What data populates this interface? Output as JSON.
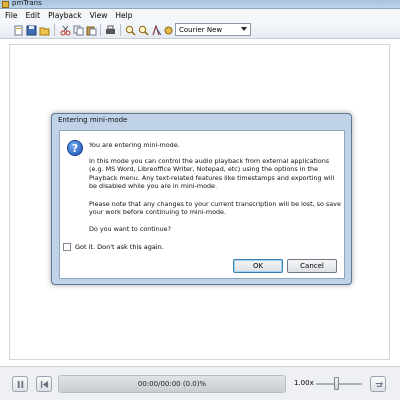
{
  "window": {
    "title": "pmTrans"
  },
  "menubar": {
    "items": [
      "File",
      "Edit",
      "Playback",
      "View",
      "Help"
    ]
  },
  "toolbar": {
    "font_select": "Courier New"
  },
  "dialog": {
    "title": "Entering mini-mode",
    "p1": "You are entering mini-mode.",
    "p2": "In this mode you can control the audio playback from external applications (e.g. MS Word, Libreoffice Writer, Notepad, etc) using the options in the Playback menu. Any text-related features like timestamps and exporting will be disabled while you are in mini-mode.",
    "p3": "Please note that any changes to your current transcription will be lost, so save your work before continuing to mini-mode.",
    "p4": "Do you want to continue?",
    "checkbox_label": "Got it. Don't ask this again.",
    "ok_label": "OK",
    "cancel_label": "Cancel"
  },
  "player": {
    "time_display": "00:00/00:00 (0.0)%",
    "speed": "1.00x"
  }
}
